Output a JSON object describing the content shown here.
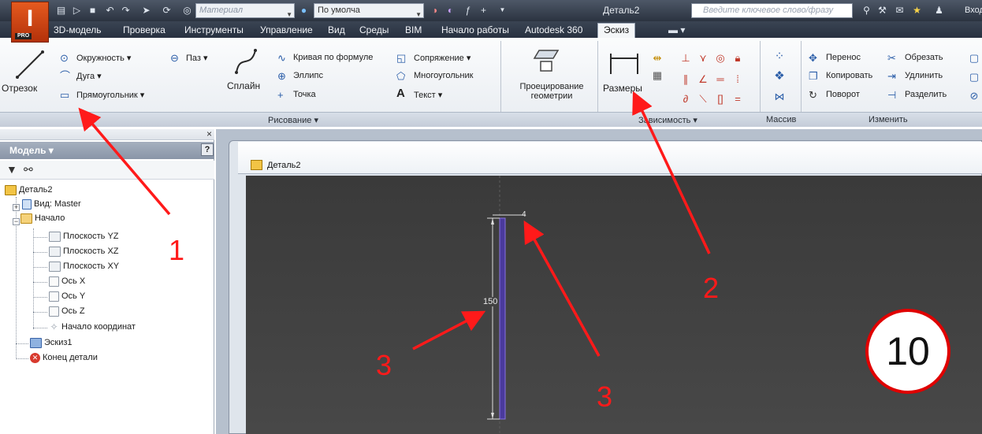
{
  "window": {
    "material_placeholder": "Материал",
    "appearance_value": "По умолча",
    "document_title": "Деталь2",
    "search_placeholder": "Введите ключевое слово/фразу",
    "login_label": "Вход"
  },
  "tabs": [
    {
      "label": "3D-модель"
    },
    {
      "label": "Проверка"
    },
    {
      "label": "Инструменты"
    },
    {
      "label": "Управление"
    },
    {
      "label": "Вид"
    },
    {
      "label": "Среды"
    },
    {
      "label": "BIM"
    },
    {
      "label": "Начало работы"
    },
    {
      "label": "Autodesk 360"
    },
    {
      "label": "Эскиз",
      "active": true
    }
  ],
  "ribbon": {
    "draw": {
      "line_label": "Отрезок",
      "circle_label": "Окружность",
      "arc_label": "Дуга",
      "rectangle_label": "Прямоугольник",
      "slot_label": "Паз",
      "spline_label": "Сплайн",
      "curve_label": "Кривая по формуле",
      "ellipse_label": "Эллипс",
      "point_label": "Точка",
      "fillet_label": "Сопряжение",
      "polygon_label": "Многоугольник",
      "text_label": "Текст",
      "panel_label": "Рисование"
    },
    "project_label_line1": "Проецирование",
    "project_label_line2": "геометрии",
    "dimension_label": "Размеры",
    "constrain_panel_label": "Зависимость",
    "pattern_panel_label": "Массив",
    "modify": {
      "move_label": "Перенос",
      "copy_label": "Копировать",
      "rotate_label": "Поворот",
      "trim_label": "Обрезать",
      "extend_label": "Удлинить",
      "split_label": "Разделить",
      "panel_label": "Изменить"
    }
  },
  "browser": {
    "header": "Модель",
    "tree": [
      {
        "label": "Деталь2",
        "icon": "part-icon"
      },
      {
        "label": "Вид: Master",
        "icon": "view-icon"
      },
      {
        "label": "Начало",
        "icon": "folder-icon"
      },
      {
        "label": "Плоскость YZ",
        "icon": "plane-icon"
      },
      {
        "label": "Плоскость XZ",
        "icon": "plane-icon"
      },
      {
        "label": "Плоскость XY",
        "icon": "plane-icon"
      },
      {
        "label": "Ось X",
        "icon": "axis-icon"
      },
      {
        "label": "Ось Y",
        "icon": "axis-icon"
      },
      {
        "label": "Ось Z",
        "icon": "axis-icon"
      },
      {
        "label": "Начало координат",
        "icon": "origin-point-icon"
      },
      {
        "label": "Эскиз1",
        "icon": "sketch-icon"
      },
      {
        "label": "Конец детали",
        "icon": "end-of-part-icon"
      }
    ]
  },
  "document": {
    "tab_label": "Деталь2",
    "dimension_height": "150",
    "dimension_width": "4"
  },
  "annotations": {
    "num1": "1",
    "num2": "2",
    "num3a": "3",
    "num3b": "3",
    "step": "10"
  },
  "colors": {
    "annotation": "#ff1a1a",
    "viewport": "#424242",
    "sketch_rect": "#5a3fb8"
  }
}
